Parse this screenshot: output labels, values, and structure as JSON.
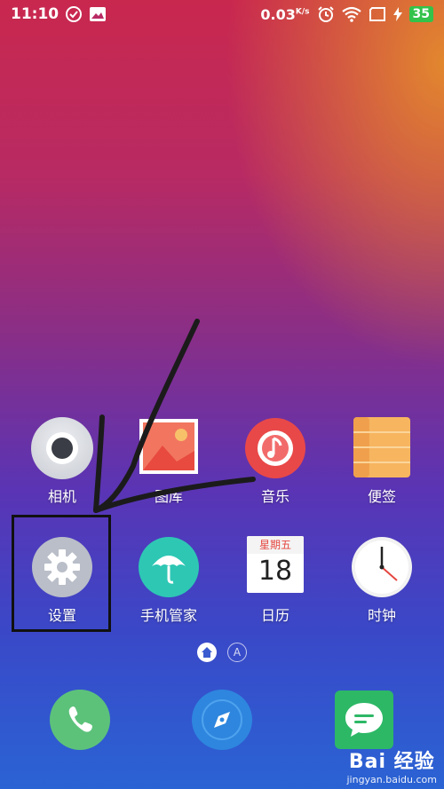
{
  "status_bar": {
    "time": "11:10",
    "speed_value": "0.03",
    "speed_unit": "K/s",
    "battery": "35"
  },
  "apps_row1": [
    {
      "label": "相机",
      "icon": "camera-icon"
    },
    {
      "label": "图库",
      "icon": "gallery-icon"
    },
    {
      "label": "音乐",
      "icon": "music-icon"
    },
    {
      "label": "便签",
      "icon": "notes-icon"
    }
  ],
  "apps_row2": [
    {
      "label": "设置",
      "icon": "settings-gear-icon"
    },
    {
      "label": "手机管家",
      "icon": "umbrella-icon"
    },
    {
      "label": "日历",
      "icon": "calendar-icon",
      "weekday": "星期五",
      "day": "18"
    },
    {
      "label": "时钟",
      "icon": "clock-icon"
    }
  ],
  "page_indicator": {
    "second": "A"
  },
  "dock": [
    {
      "icon": "phone-icon"
    },
    {
      "icon": "browser-compass-icon"
    },
    {
      "icon": "messages-icon"
    }
  ],
  "watermark": {
    "brand": "Bai 经验",
    "domain": "jingyan.baidu.com"
  },
  "colors": {
    "camera": "#d9dbe0",
    "gallery": "#ef5b4a",
    "music": "#ea4b4b",
    "notes": "#f5b766",
    "settings": "#b7bcc6",
    "manager": "#2ec8b5",
    "phone": "#5cc27a",
    "browser": "#2f8ae0",
    "messages": "#2eb866",
    "battery": "#33c24a"
  }
}
